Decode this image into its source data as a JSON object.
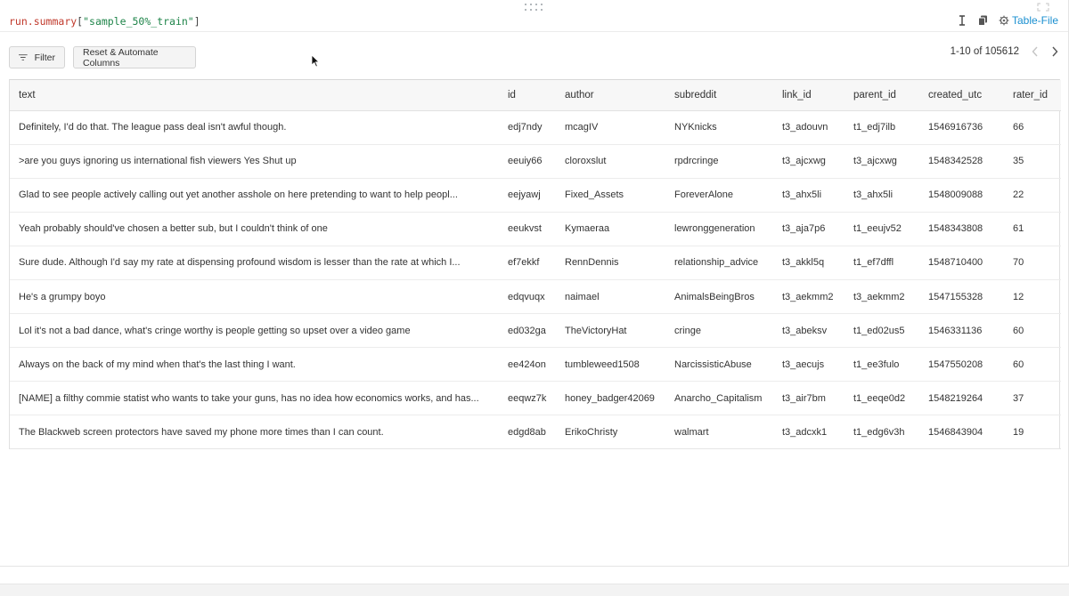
{
  "code": {
    "object": "run",
    "attr": ".summary",
    "open": "[",
    "key": "\"sample_50%_train\"",
    "close": "]"
  },
  "toolbar": {
    "table_file_label": "Table-File",
    "filter_label": "Filter",
    "reset_label": "Reset & Automate Columns"
  },
  "pager": {
    "range": "1-10 of 105612"
  },
  "table": {
    "columns": [
      "text",
      "id",
      "author",
      "subreddit",
      "link_id",
      "parent_id",
      "created_utc",
      "rater_id"
    ],
    "rows": [
      [
        "Definitely, I'd do that. The league pass deal isn't awful though.",
        "edj7ndy",
        "mcagIV",
        "NYKnicks",
        "t3_adouvn",
        "t1_edj7ilb",
        "1546916736",
        "66"
      ],
      [
        ">are you guys ignoring us international fish viewers Yes Shut up",
        "eeuiy66",
        "cloroxslut",
        "rpdrcringe",
        "t3_ajcxwg",
        "t3_ajcxwg",
        "1548342528",
        "35"
      ],
      [
        "Glad to see people actively calling out yet another asshole on here pretending to want to help peopl...",
        "eejyawj",
        "Fixed_Assets",
        "ForeverAlone",
        "t3_ahx5li",
        "t3_ahx5li",
        "1548009088",
        "22"
      ],
      [
        "Yeah probably should've chosen a better sub, but I couldn't think of one",
        "eeukvst",
        "Kymaeraa",
        "lewronggeneration",
        "t3_aja7p6",
        "t1_eeujv52",
        "1548343808",
        "61"
      ],
      [
        "Sure dude. Although I'd say my rate at dispensing profound wisdom is lesser than the rate at which I...",
        "ef7ekkf",
        "RennDennis",
        "relationship_advice",
        "t3_akkl5q",
        "t1_ef7dffl",
        "1548710400",
        "70"
      ],
      [
        "He's a grumpy boyo",
        "edqvuqx",
        "naimael",
        "AnimalsBeingBros",
        "t3_aekmm2",
        "t3_aekmm2",
        "1547155328",
        "12"
      ],
      [
        "Lol it's not a bad dance, what's cringe worthy is people getting so upset over a video game",
        "ed032ga",
        "TheVictoryHat",
        "cringe",
        "t3_abeksv",
        "t1_ed02us5",
        "1546331136",
        "60"
      ],
      [
        "Always on the back of my mind when that's the last thing I want.",
        "ee424on",
        "tumbleweed1508",
        "NarcissisticAbuse",
        "t3_aecujs",
        "t1_ee3fulo",
        "1547550208",
        "60"
      ],
      [
        "[NAME] a filthy commie statist who wants to take your guns, has no idea how economics works, and has...",
        "eeqwz7k",
        "honey_badger42069",
        "Anarcho_Capitalism",
        "t3_air7bm",
        "t1_eeqe0d2",
        "1548219264",
        "37"
      ],
      [
        "The Blackweb screen protectors have saved my phone more times than I can count.",
        "edgd8ab",
        "ErikoChristy",
        "walmart",
        "t3_adcxk1",
        "t1_edg6v3h",
        "1546843904",
        "19"
      ]
    ]
  },
  "icons": {
    "drag": "drag-handle-icon",
    "fullscreen": "fullscreen-icon",
    "text_cursor": "text-cursor-icon",
    "copy": "copy-icon",
    "gear": "gear-icon",
    "filter": "filter-icon",
    "prev": "chevron-left-icon",
    "next": "chevron-right-icon"
  },
  "colors": {
    "link": "#1a8fd0",
    "code_object": "#c0392b",
    "code_string": "#1e8449"
  }
}
